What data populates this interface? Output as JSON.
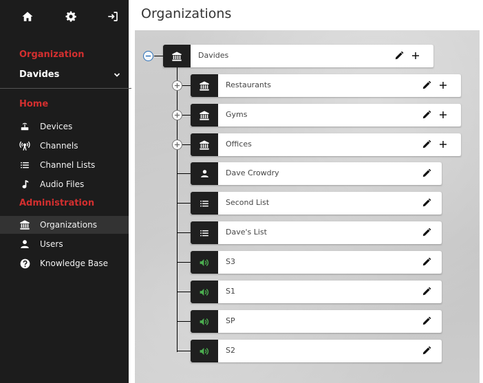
{
  "sidebar": {
    "top_icons": [
      "home-icon",
      "gear-icon",
      "logout-icon"
    ],
    "organization_label": "Organization",
    "organization_value": "Davides",
    "home_label": "Home",
    "home_items": [
      {
        "label": "Devices",
        "icon": "device-icon"
      },
      {
        "label": "Channels",
        "icon": "broadcast-icon"
      },
      {
        "label": "Channel Lists",
        "icon": "list-icon"
      },
      {
        "label": "Audio Files",
        "icon": "music-note-icon"
      }
    ],
    "admin_label": "Administration",
    "admin_items": [
      {
        "label": "Organizations",
        "icon": "bank-icon",
        "active": true
      },
      {
        "label": "Users",
        "icon": "user-icon"
      },
      {
        "label": "Knowledge Base",
        "icon": "help-icon"
      }
    ]
  },
  "header": {
    "title": "Organizations"
  },
  "tree": {
    "root": {
      "label": "Davides",
      "icon": "bank-icon",
      "expanded": true
    },
    "children": [
      {
        "label": "Restaurants",
        "icon": "bank-icon",
        "type": "organization"
      },
      {
        "label": "Gyms",
        "icon": "bank-icon",
        "type": "organization"
      },
      {
        "label": "Offices",
        "icon": "bank-icon",
        "type": "organization"
      },
      {
        "label": "Dave Crowdry",
        "icon": "user-icon",
        "type": "user"
      },
      {
        "label": "Second List",
        "icon": "list-icon",
        "type": "channel-list"
      },
      {
        "label": "Dave's List",
        "icon": "list-icon",
        "type": "channel-list"
      },
      {
        "label": "S3",
        "icon": "speaker-icon",
        "type": "channel"
      },
      {
        "label": "S1",
        "icon": "speaker-icon",
        "type": "channel"
      },
      {
        "label": "SP",
        "icon": "speaker-icon",
        "type": "channel"
      },
      {
        "label": "S2",
        "icon": "speaker-icon",
        "type": "channel"
      }
    ]
  },
  "colors": {
    "sidebar_bg": "#1c1c1c",
    "accent_red": "#d32f2f",
    "speaker_green": "#4caf50",
    "badge_bg": "#1f1f1f"
  }
}
